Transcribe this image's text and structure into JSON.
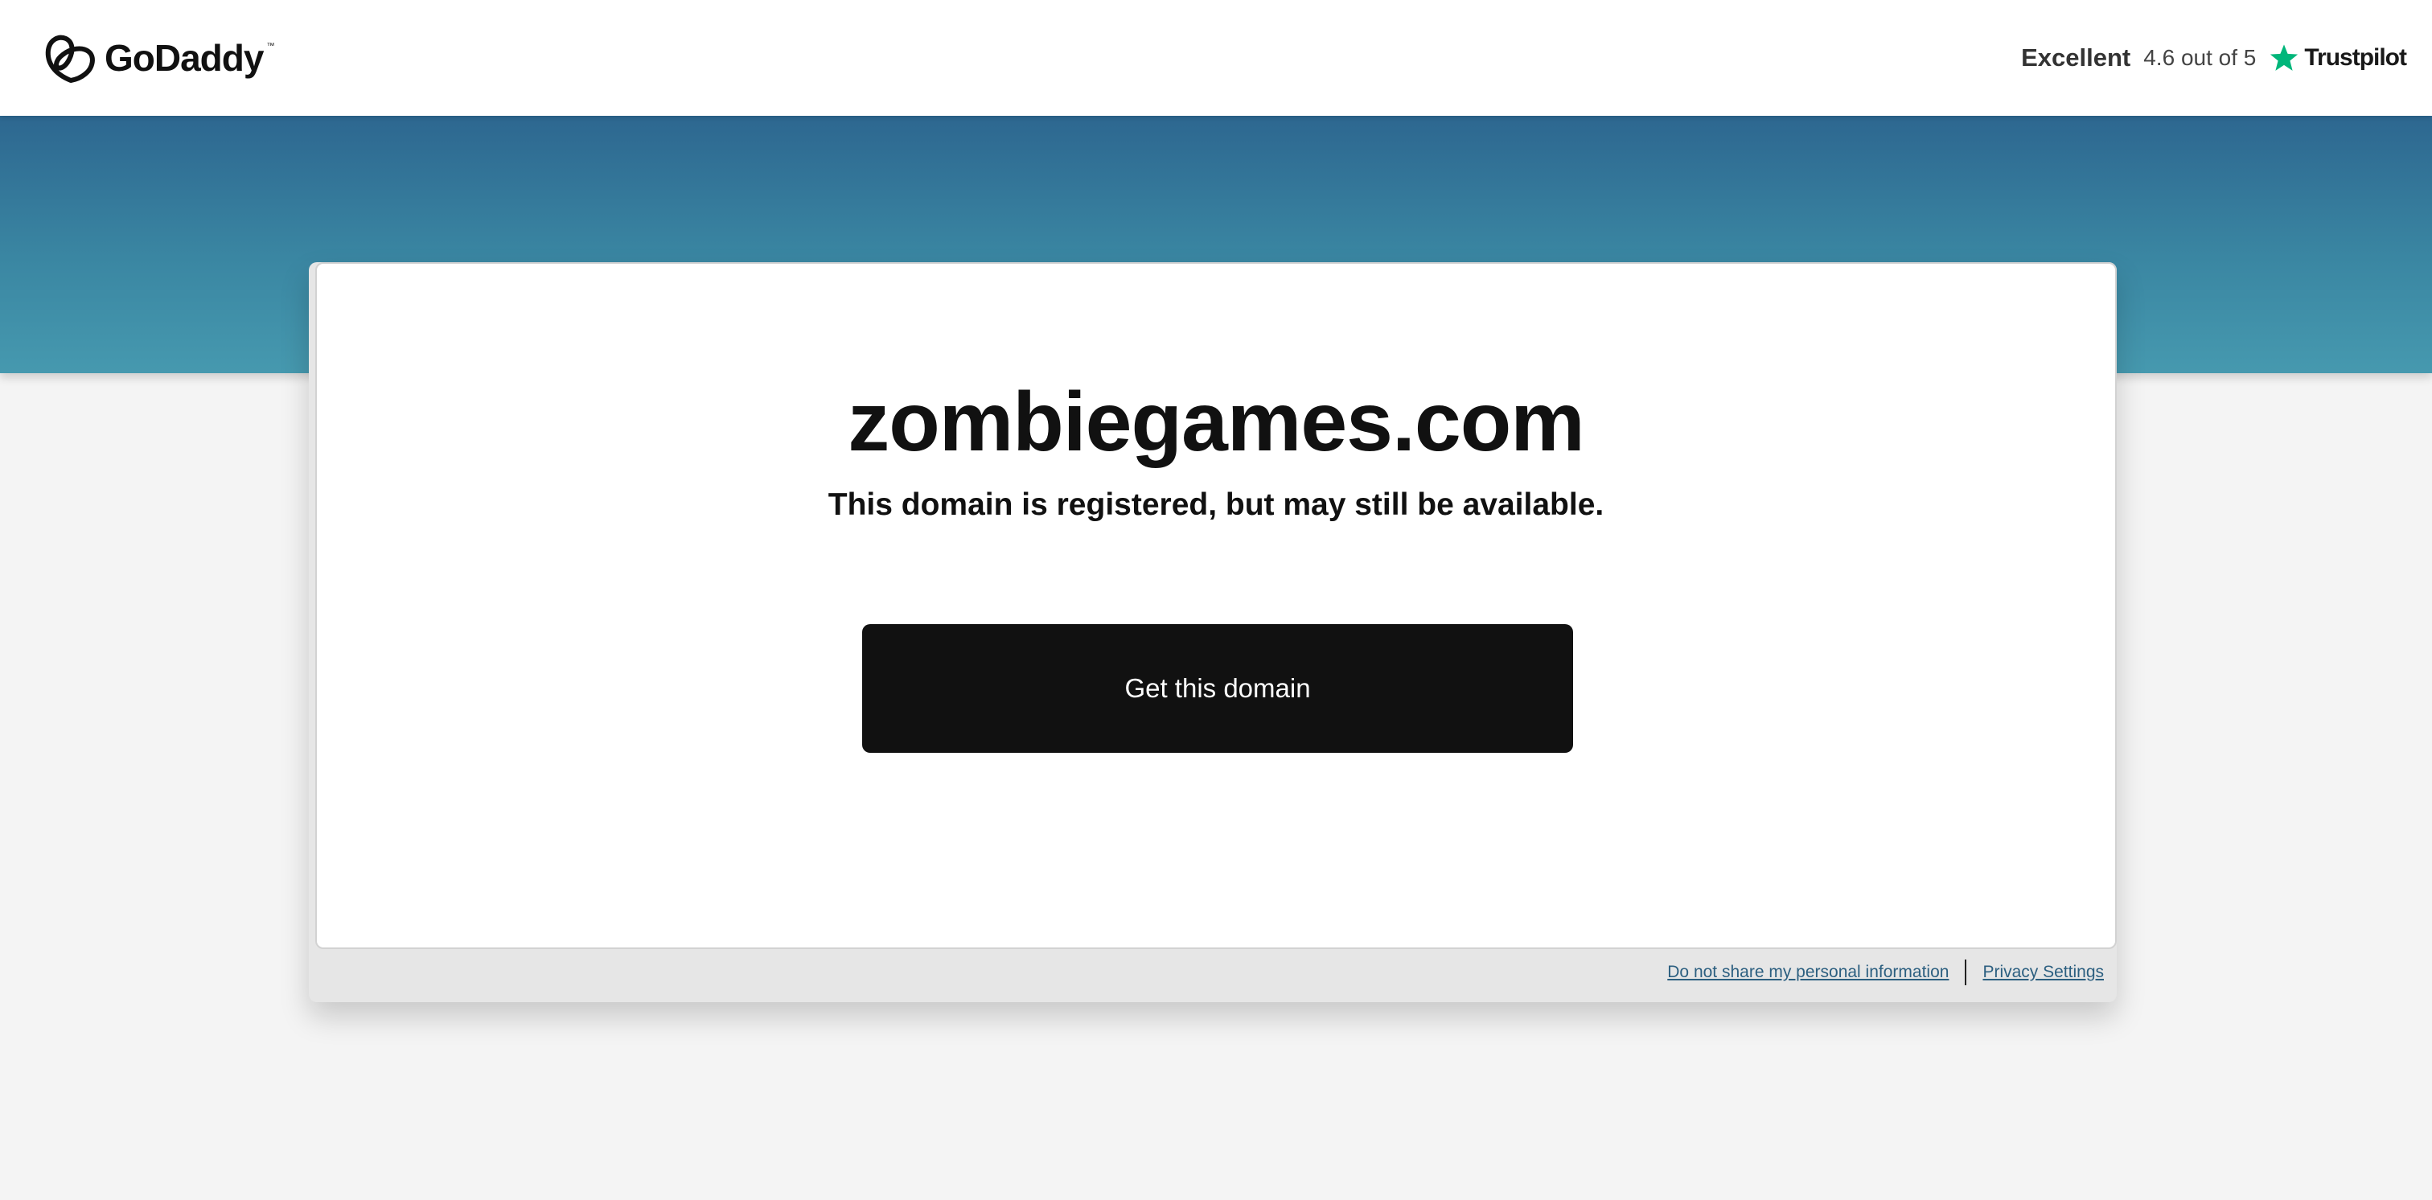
{
  "header": {
    "logo_text": "GoDaddy",
    "logo_tm": "™",
    "rating_label": "Excellent",
    "rating_score": "4.6 out of 5",
    "trustpilot_label": "Trustpilot"
  },
  "main": {
    "domain": "zombiegames.com",
    "subtitle": "This domain is registered, but may still be available.",
    "cta_label": "Get this domain"
  },
  "footer": {
    "links": [
      "Do not share my personal information",
      "Privacy Settings"
    ]
  },
  "colors": {
    "hero_top": "#2d6790",
    "hero_bottom": "#4699af",
    "button": "#111111",
    "trustpilot_star": "#00b67a",
    "link": "#2c5f80"
  }
}
